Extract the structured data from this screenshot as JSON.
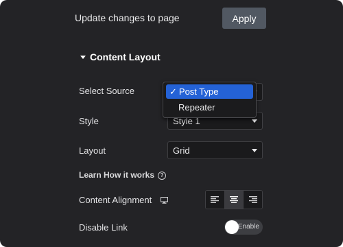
{
  "header": {
    "update_text": "Update changes to page",
    "apply_label": "Apply"
  },
  "section": {
    "title": "Content Layout"
  },
  "fields": {
    "select_source": {
      "label": "Select Source",
      "value": "Post Type"
    },
    "style": {
      "label": "Style",
      "value": "Style 1"
    },
    "layout": {
      "label": "Layout",
      "value": "Grid"
    },
    "learn_link": "Learn How it works",
    "content_alignment": {
      "label": "Content Alignment",
      "selected": "center"
    },
    "disable_link": {
      "label": "Disable Link",
      "toggle_label": "Enable",
      "enabled": false
    }
  },
  "dropdown": {
    "items": [
      {
        "label": "Post Type",
        "selected": true
      },
      {
        "label": "Repeater",
        "selected": false
      }
    ],
    "checkmark": "✓"
  },
  "colors": {
    "panel_bg": "#232326",
    "accent": "#2462d6",
    "apply_bg": "#515862"
  },
  "icons": {
    "section_caret": "caret-down-icon",
    "help": "help-circle-icon",
    "device": "desktop-monitor-icon",
    "align": [
      "align-left-icon",
      "align-center-icon",
      "align-right-icon"
    ]
  }
}
